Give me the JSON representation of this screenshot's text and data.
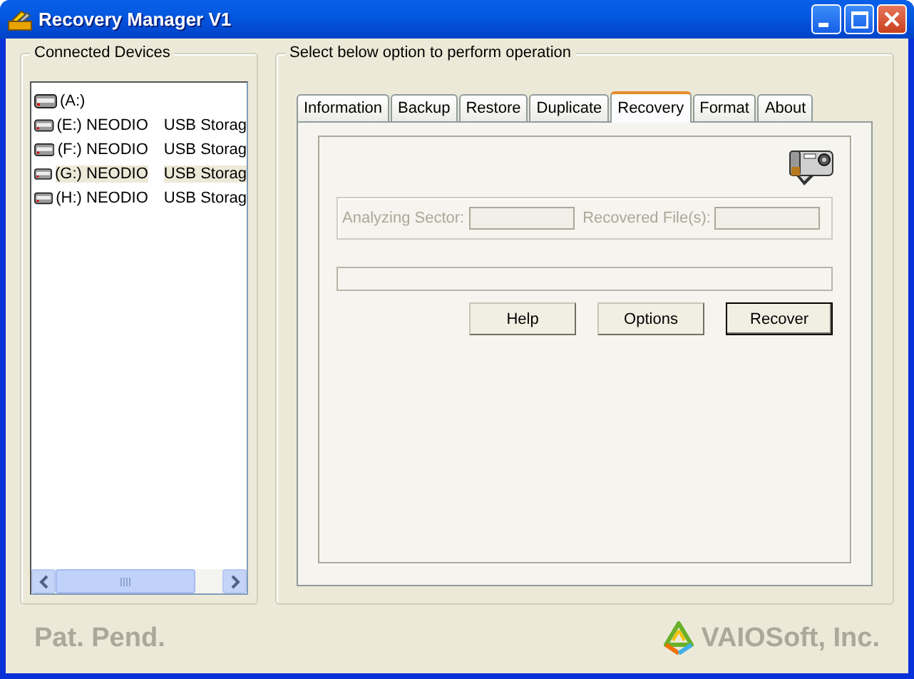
{
  "window": {
    "title": "Recovery Manager V1"
  },
  "devices": {
    "title": "Connected Devices",
    "items": [
      {
        "drive": "(A:)",
        "selected": false
      },
      {
        "drive": "(E:) NEODIO",
        "type": "USB Storag",
        "selected": false
      },
      {
        "drive": "(F:) NEODIO",
        "type": "USB Storag",
        "selected": false
      },
      {
        "drive": "(G:) NEODIO",
        "type": "USB Storag",
        "selected": true
      },
      {
        "drive": "(H:) NEODIO",
        "type": "USB Storag",
        "selected": false
      }
    ]
  },
  "operations": {
    "title": "Select below option to perform operation",
    "tabs": [
      {
        "label": "Information",
        "selected": false
      },
      {
        "label": "Backup",
        "selected": false
      },
      {
        "label": "Restore",
        "selected": false
      },
      {
        "label": "Duplicate",
        "selected": false
      },
      {
        "label": "Recovery",
        "selected": true
      },
      {
        "label": "Format",
        "selected": false
      },
      {
        "label": "About",
        "selected": false
      }
    ],
    "fields": [
      {
        "label": "Analyzing Sector:",
        "disabled": true
      },
      {
        "label": "Recovered File(s):",
        "disabled": true
      }
    ],
    "buttons": [
      {
        "label": "Help",
        "default": false
      },
      {
        "label": "Options",
        "default": false
      },
      {
        "label": "Recover",
        "default": true
      }
    ]
  },
  "footer": {
    "patent": "Pat. Pend.",
    "company": "VAIOSoft, Inc."
  }
}
